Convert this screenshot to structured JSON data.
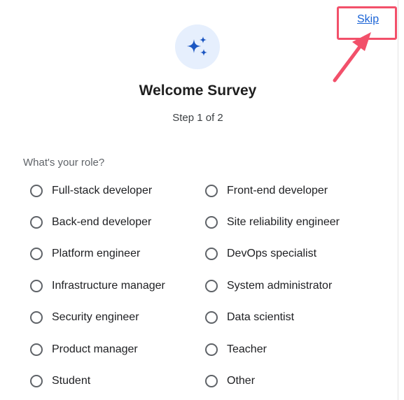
{
  "header": {
    "skip_label": "Skip"
  },
  "hero": {
    "icon": "sparkles-icon"
  },
  "survey": {
    "title": "Welcome Survey",
    "step": "Step 1 of 2",
    "question": "What's your role?",
    "options": [
      "Full-stack developer",
      "Front-end developer",
      "Back-end developer",
      "Site reliability engineer",
      "Platform engineer",
      "DevOps specialist",
      "Infrastructure manager",
      "System administrator",
      "Security engineer",
      "Data scientist",
      "Product manager",
      "Teacher",
      "Student",
      "Other"
    ]
  },
  "colors": {
    "accent": "#1a63d6",
    "icon_bg": "#e6effd",
    "annotation": "#f2506a"
  }
}
